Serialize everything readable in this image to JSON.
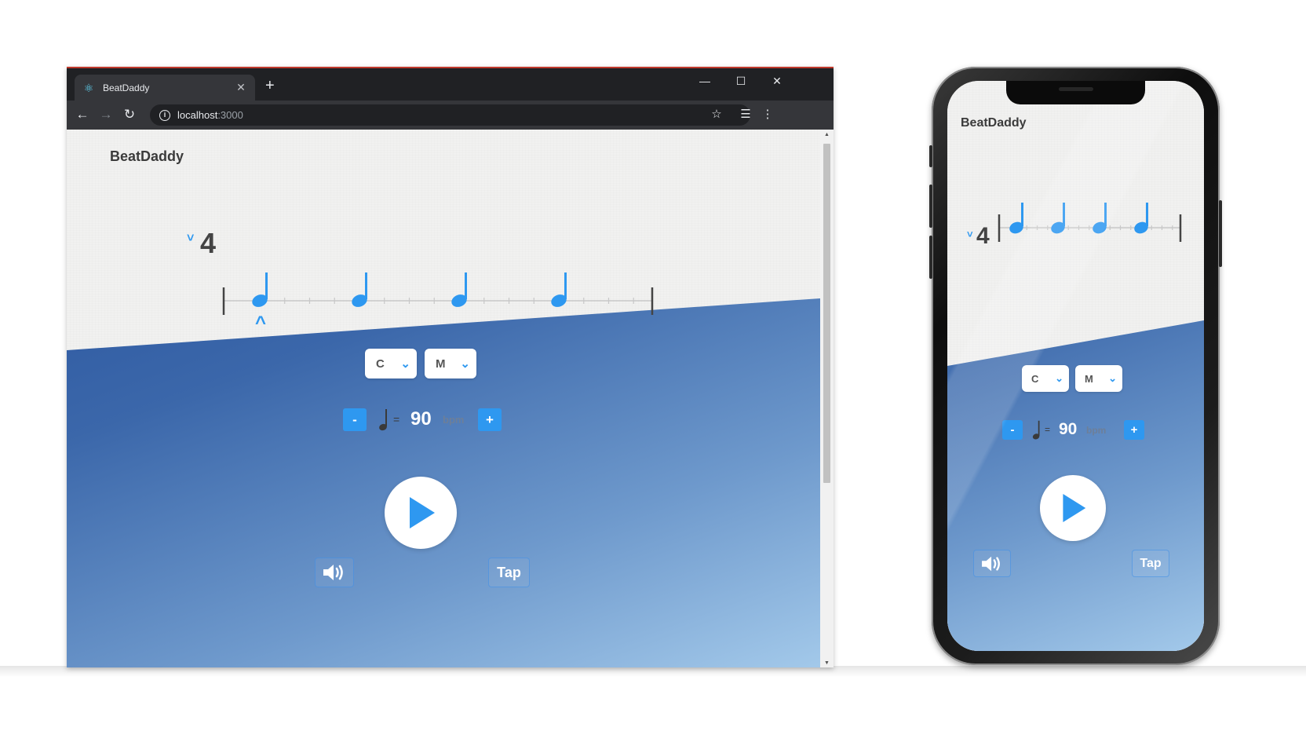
{
  "browser": {
    "tab_title": "BeatDaddy",
    "tab_close": "✕",
    "new_tab": "+",
    "window_controls": {
      "minimize": "—",
      "maximize": "☐",
      "close": "✕"
    },
    "url_host": "localhost",
    "url_port": ":3000",
    "nav": {
      "back": "←",
      "forward": "→",
      "reload": "↻"
    },
    "toolbar_icons": {
      "bookmark": "☆",
      "extension": "☰",
      "menu": "⋮"
    }
  },
  "app": {
    "logo": "BeatDaddy",
    "time_signature": {
      "value": "4",
      "chevron": "˅"
    },
    "measure": {
      "beats": 4,
      "subdivisions_per_beat": 4,
      "current_beat": 1,
      "cursor_glyph": "^"
    },
    "key_select": {
      "value": "C",
      "caret": "⌄"
    },
    "mode_select": {
      "value": "M",
      "caret": "⌄"
    },
    "tempo": {
      "minus": "-",
      "plus": "+",
      "equals": "=",
      "value": "90",
      "unit": "bpm"
    },
    "tap_label": "Tap"
  },
  "colors": {
    "accent": "#2e98f0",
    "paper": "#f1f1f0",
    "blue_dark": "#244f9b",
    "blue_light": "#a3c9ea"
  }
}
